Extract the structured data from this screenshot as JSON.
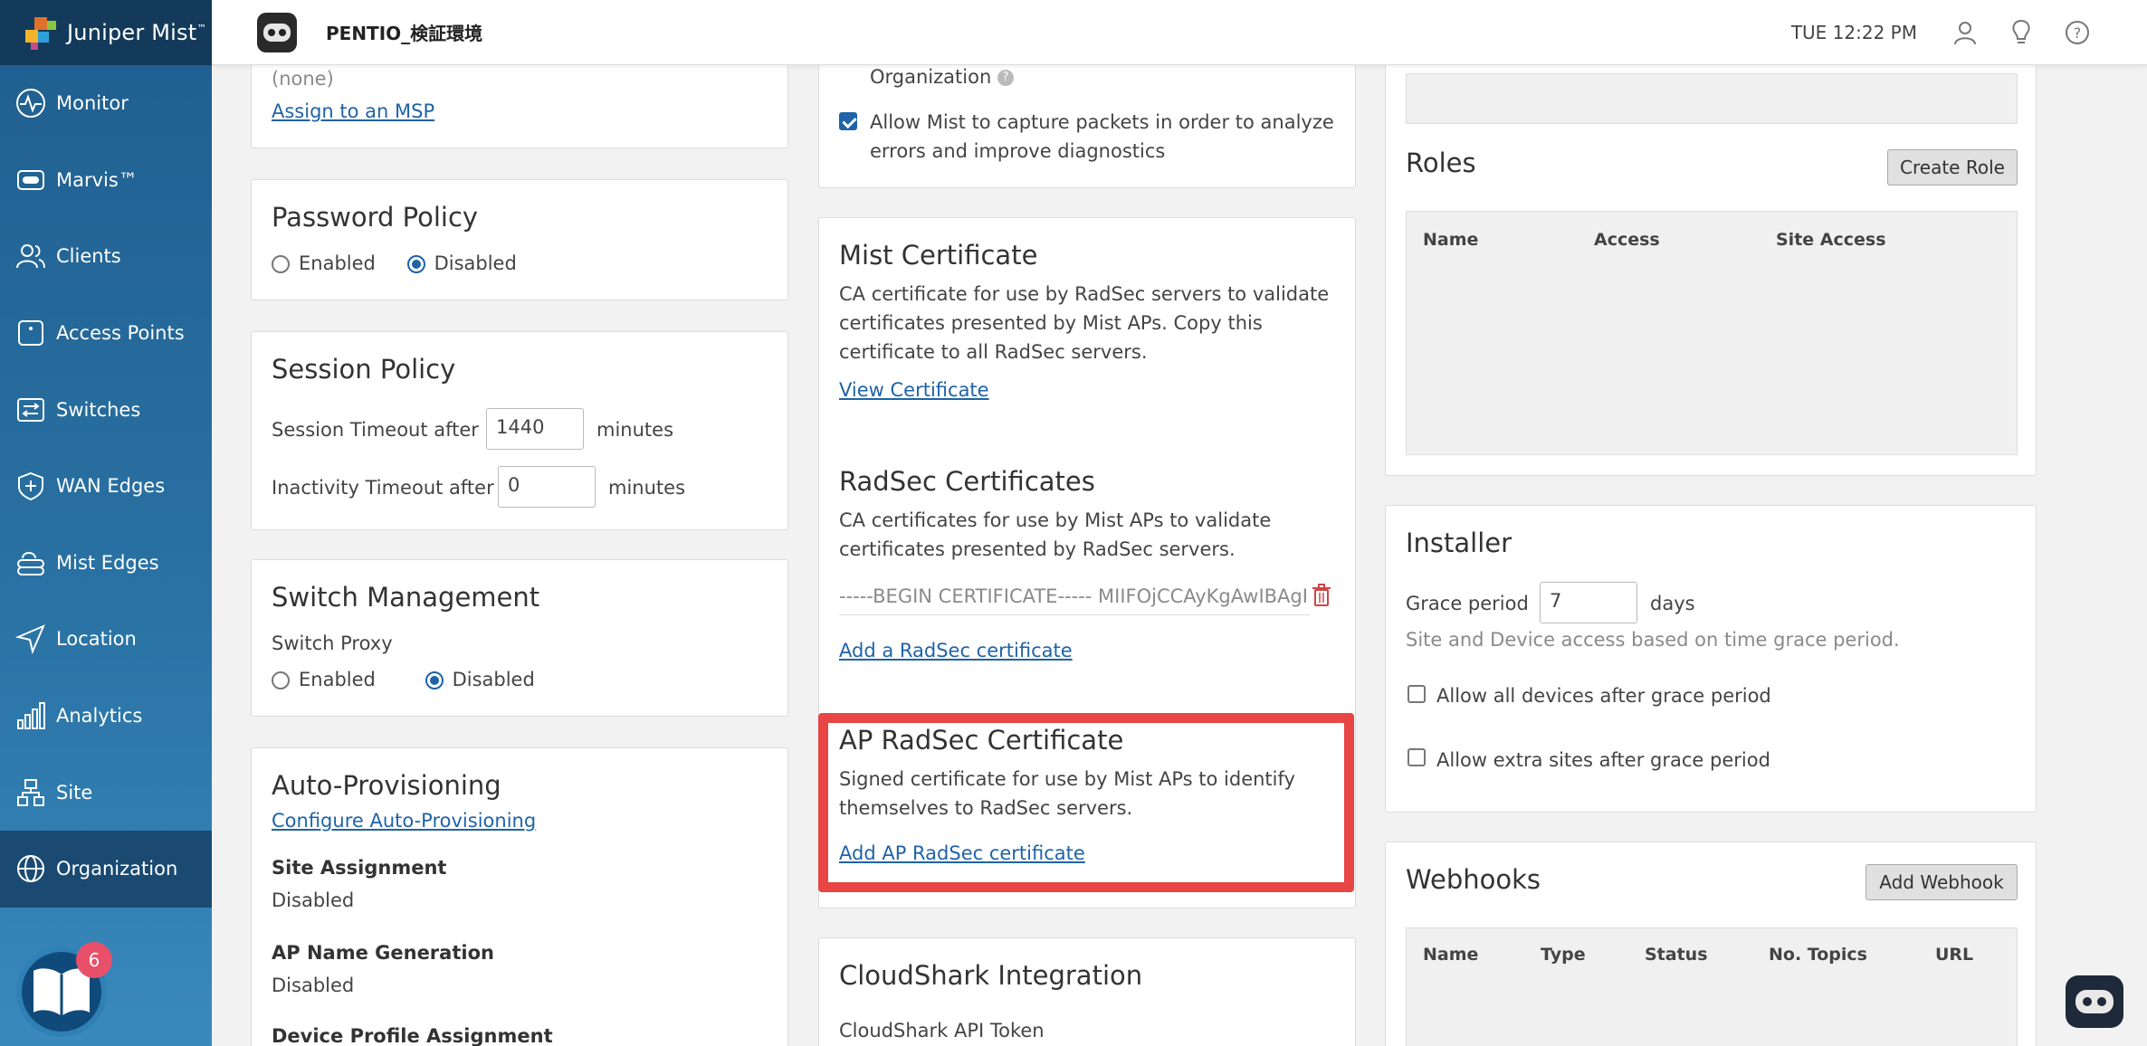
{
  "brand": {
    "name": "Juniper Mist",
    "tm": "™"
  },
  "nav": [
    {
      "label": "Monitor",
      "icon": "monitor-icon"
    },
    {
      "label": "Marvis™",
      "icon": "marvis-icon"
    },
    {
      "label": "Clients",
      "icon": "clients-icon"
    },
    {
      "label": "Access Points",
      "icon": "access-point-icon"
    },
    {
      "label": "Switches",
      "icon": "switches-icon"
    },
    {
      "label": "WAN Edges",
      "icon": "wan-edge-icon"
    },
    {
      "label": "Mist Edges",
      "icon": "mist-edge-icon"
    },
    {
      "label": "Location",
      "icon": "location-icon"
    },
    {
      "label": "Analytics",
      "icon": "analytics-icon"
    },
    {
      "label": "Site",
      "icon": "site-icon"
    },
    {
      "label": "Organization",
      "icon": "organization-icon",
      "active": true
    }
  ],
  "help_badge": "6",
  "header": {
    "site": "PENTIO_検証環境",
    "time": "TUE 12:22 PM"
  },
  "msp": {
    "value": "(none)",
    "assign_link": "Assign to an MSP"
  },
  "password_policy": {
    "title": "Password Policy",
    "enabled": "Enabled",
    "disabled": "Disabled"
  },
  "session_policy": {
    "title": "Session Policy",
    "timeout_label": "Session Timeout after",
    "timeout_value": "1440",
    "timeout_unit": "minutes",
    "inactivity_label": "Inactivity Timeout after",
    "inactivity_value": "0",
    "inactivity_unit": "minutes"
  },
  "switch_mgmt": {
    "title": "Switch Management",
    "proxy_label": "Switch Proxy",
    "enabled": "Enabled",
    "disabled": "Disabled"
  },
  "auto_prov": {
    "title": "Auto-Provisioning",
    "configure_link": "Configure Auto-Provisioning",
    "site_assignment_label": "Site Assignment",
    "site_assignment_value": "Disabled",
    "ap_name_label": "AP Name Generation",
    "ap_name_value": "Disabled",
    "device_profile_label": "Device Profile Assignment"
  },
  "support": {
    "org_label": "Organization",
    "capture_label": "Allow Mist to capture packets in order to analyze errors and improve diagnostics"
  },
  "mist_cert": {
    "title": "Mist Certificate",
    "desc": "CA certificate for use by RadSec servers to validate certificates presented by Mist APs. Copy this certificate to all RadSec servers.",
    "view_link": "View Certificate"
  },
  "radsec": {
    "title": "RadSec Certificates",
    "desc": "CA certificates for use by Mist APs to validate certificates presented by RadSec servers.",
    "cert_value": "-----BEGIN CERTIFICATE----- MIIFOjCCAyKgAwIBAgI...",
    "add_link": "Add a RadSec certificate"
  },
  "ap_radsec": {
    "title": "AP RadSec Certificate",
    "desc": "Signed certificate for use by Mist APs to identify themselves to RadSec servers.",
    "add_link": "Add AP RadSec certificate"
  },
  "cloudshark": {
    "title": "CloudShark Integration",
    "token_label": "CloudShark API Token"
  },
  "roles": {
    "title": "Roles",
    "create": "Create Role",
    "columns": [
      "Name",
      "Access",
      "Site Access"
    ]
  },
  "installer": {
    "title": "Installer",
    "grace_label": "Grace period",
    "grace_value": "7",
    "grace_unit": "days",
    "note": "Site and Device access based on time grace period.",
    "allow_devices": "Allow all devices after grace period",
    "allow_sites": "Allow extra sites after grace period"
  },
  "webhooks": {
    "title": "Webhooks",
    "add": "Add Webhook",
    "columns": [
      "Name",
      "Type",
      "Status",
      "No. Topics",
      "URL"
    ]
  },
  "colors": {
    "sidebar": "#2a73a5",
    "accent": "#1f63a8",
    "highlight": "#e84545"
  }
}
